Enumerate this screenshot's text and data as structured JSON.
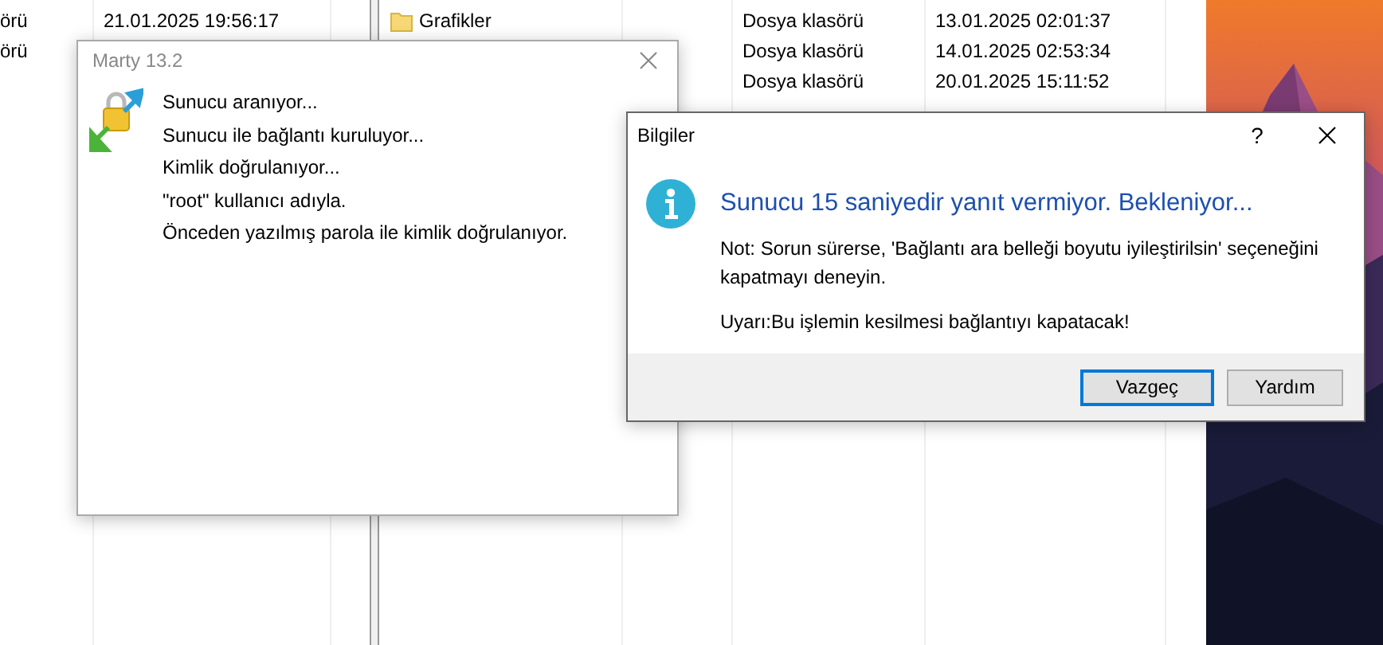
{
  "file_list_left": {
    "rows": [
      {
        "column_1": "örü",
        "column_2": "21.01.2025 19:56:17"
      },
      {
        "column_1": "örü"
      }
    ]
  },
  "file_list_right": {
    "rows": [
      {
        "name": "Grafikler",
        "type": "Dosya klasörü",
        "modified": "13.01.2025 02:01:37"
      },
      {
        "type": "Dosya klasörü",
        "modified": "14.01.2025 02:53:34"
      },
      {
        "type": "Dosya klasörü",
        "modified": "20.01.2025 15:11:52"
      }
    ]
  },
  "progress_window": {
    "title": "Marty 13.2",
    "log": [
      "Sunucu aranıyor...",
      "Sunucu ile bağlantı kuruluyor...",
      "Kimlik doğrulanıyor...",
      "\"root\" kullanıcı adıyla.",
      "Önceden yazılmış parola ile kimlik doğrulanıyor."
    ]
  },
  "info_dialog": {
    "title": "Bilgiler",
    "help_button": "?",
    "heading": "Sunucu 15 saniyedir yanıt vermiyor. Bekleniyor...",
    "note": "Not: Sorun sürerse, 'Bağlantı ara belleği boyutu iyileştirilsin' seçeneğini kapatmayı deneyin.",
    "warning": "Uyarı:Bu işlemin kesilmesi bağlantıyı kapatacak!",
    "buttons": [
      {
        "label": "Vazgeç",
        "default": true
      },
      {
        "label": "Yardım",
        "default": false
      }
    ]
  }
}
